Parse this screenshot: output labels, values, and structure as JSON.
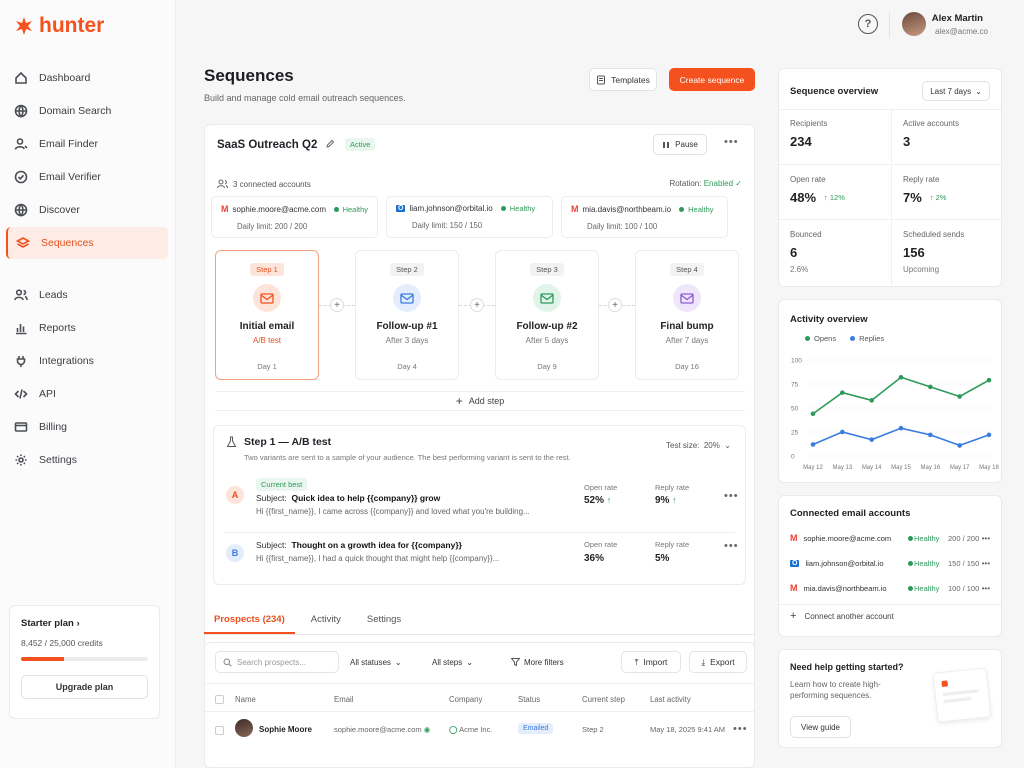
{
  "app": {
    "logo_text": "hunter",
    "brand_color": "#f4511e"
  },
  "sidebar": {
    "items": [
      {
        "label": "Dashboard",
        "icon": "home-icon"
      },
      {
        "label": "Domain Search",
        "icon": "globe-icon"
      },
      {
        "label": "Email Finder",
        "icon": "user-search-icon"
      },
      {
        "label": "Email Verifier",
        "icon": "check-circle-icon"
      },
      {
        "label": "Discover",
        "icon": "globe-icon"
      },
      {
        "label": "Sequences",
        "icon": "layers-icon",
        "active": true
      }
    ],
    "items2": [
      {
        "label": "Leads",
        "icon": "users-icon"
      },
      {
        "label": "Reports",
        "icon": "bar-chart-icon"
      },
      {
        "label": "Integrations",
        "icon": "plug-icon"
      },
      {
        "label": "API",
        "icon": "code-icon"
      },
      {
        "label": "Billing",
        "icon": "card-icon"
      },
      {
        "label": "Settings",
        "icon": "gear-icon"
      }
    ],
    "plan": {
      "title": "Starter plan",
      "chevron": "›",
      "credits": "8,452 / 25,000 credits",
      "progress": 0.338,
      "upgrade_label": "Upgrade plan"
    }
  },
  "topbar": {
    "help": "?",
    "user_name": "Alex Martin",
    "user_email": "alex@acme.co"
  },
  "page": {
    "title": "Sequences",
    "subtitle": "Build and manage cold email outreach sequences.",
    "templates_label": "Templates",
    "create_label": "Create sequence"
  },
  "sequence": {
    "name": "SaaS Outreach Q2",
    "status": "Active",
    "pause_label": "Pause",
    "accounts_label": "3 connected accounts",
    "rotation_label": "Rotation:",
    "rotation_value": "Enabled",
    "accounts": [
      {
        "email": "sophie.moore@acme.com",
        "status": "Healthy",
        "limit": "Daily limit: 200 / 200",
        "provider": "gmail"
      },
      {
        "email": "liam.johnson@orbital.io",
        "status": "Healthy",
        "limit": "Daily limit: 150 / 150",
        "provider": "outlook"
      },
      {
        "email": "mia.davis@northbeam.io",
        "status": "Healthy",
        "limit": "Daily limit: 100 / 100",
        "provider": "gmail"
      }
    ],
    "steps": [
      {
        "pill": "Step 1",
        "title": "Initial email",
        "sub": "A/B test",
        "day": "Day 1",
        "color": "#f4511e",
        "bg": "#fde4da"
      },
      {
        "pill": "Step 2",
        "title": "Follow-up #1",
        "sub": "After 3 days",
        "day": "Day 4",
        "color": "#3b7be0",
        "bg": "#e3edfb"
      },
      {
        "pill": "Step 3",
        "title": "Follow-up #2",
        "sub": "After 5 days",
        "day": "Day 9",
        "color": "#2e9a5a",
        "bg": "#e2f4e9"
      },
      {
        "pill": "Step 4",
        "title": "Final bump",
        "sub": "After 7 days",
        "day": "Day 16",
        "color": "#8a5bd6",
        "bg": "#efe6fb"
      }
    ],
    "add_step_label": "Add step"
  },
  "ab_test": {
    "title": "Step 1 — A/B test",
    "description": "Two variants are sent to a sample of your audience. The best performing variant is sent to the rest.",
    "test_size_label": "Test size:",
    "test_size_value": "20%",
    "variants": [
      {
        "letter": "A",
        "badge": "Current best",
        "subject_label": "Subject:",
        "subject": "Quick idea to help {{company}} grow",
        "body": "Hi {{first_name}}, I came across {{company}} and loved what you're building...",
        "open_label": "Open rate",
        "open": "52%",
        "reply_label": "Reply rate",
        "reply": "9%"
      },
      {
        "letter": "B",
        "badge": "",
        "subject_label": "Subject:",
        "subject": "Thought on a growth idea for {{company}}",
        "body": "Hi {{first_name}}, I had a quick thought that might help {{company}}...",
        "open_label": "Open rate",
        "open": "36%",
        "reply_label": "Reply rate",
        "reply": "5%"
      }
    ]
  },
  "tabs": [
    {
      "label": "Prospects (234)",
      "active": true
    },
    {
      "label": "Activity"
    },
    {
      "label": "Settings"
    }
  ],
  "prospects": {
    "search_placeholder": "Search prospects...",
    "filter_status": "All statuses",
    "filter_steps": "All steps",
    "more_filters": "More filters",
    "import_label": "Import",
    "export_label": "Export",
    "columns": [
      "Name",
      "Email",
      "Company",
      "Status",
      "Current step",
      "Last activity"
    ],
    "rows": [
      {
        "name": "Sophie Moore",
        "email": "sophie.moore@acme.com",
        "company": "Acme Inc.",
        "status": "Emailed",
        "step": "Step 2",
        "last_activity": "May 18, 2025 9:41 AM"
      }
    ]
  },
  "overview": {
    "title": "Sequence overview",
    "range": "Last 7 days",
    "stats": [
      {
        "label": "Recipients",
        "value": "234",
        "delta": "",
        "sub": ""
      },
      {
        "label": "Active accounts",
        "value": "3",
        "delta": "",
        "sub": ""
      },
      {
        "label": "Open rate",
        "value": "48%",
        "delta": "12%",
        "sub": ""
      },
      {
        "label": "Reply rate",
        "value": "7%",
        "delta": "2%",
        "sub": ""
      },
      {
        "label": "Bounced",
        "value": "6",
        "delta": "",
        "sub": "2.6%"
      },
      {
        "label": "Scheduled sends",
        "value": "156",
        "delta": "",
        "sub": "Upcoming"
      }
    ]
  },
  "activity": {
    "title": "Activity overview",
    "legend_opens": "Opens",
    "legend_replies": "Replies"
  },
  "chart_data": {
    "type": "line",
    "x": [
      "May 12",
      "May 13",
      "May 14",
      "May 15",
      "May 16",
      "May 17",
      "May 18"
    ],
    "series": [
      {
        "name": "Opens",
        "values": [
          44,
          66,
          58,
          82,
          72,
          62,
          79
        ],
        "color": "#2e9a5a"
      },
      {
        "name": "Replies",
        "values": [
          12,
          25,
          17,
          29,
          22,
          11,
          22
        ],
        "color": "#3b7be0"
      }
    ],
    "yticks": [
      "100",
      "75",
      "50",
      "25",
      "0"
    ],
    "ylim": [
      0,
      100
    ],
    "grid": true,
    "legend": "top-left"
  },
  "connected": {
    "title": "Connected email accounts",
    "accounts": [
      {
        "email": "sophie.moore@acme.com",
        "status": "Healthy",
        "limit": "200 / 200",
        "provider": "gmail"
      },
      {
        "email": "liam.johnson@orbital.io",
        "status": "Healthy",
        "limit": "150 / 150",
        "provider": "outlook"
      },
      {
        "email": "mia.davis@northbeam.io",
        "status": "Healthy",
        "limit": "100 / 100",
        "provider": "gmail"
      }
    ],
    "connect_label": "Connect another account"
  },
  "help": {
    "title": "Need help getting started?",
    "text": "Learn how to create high-performing sequences.",
    "button": "View guide"
  }
}
